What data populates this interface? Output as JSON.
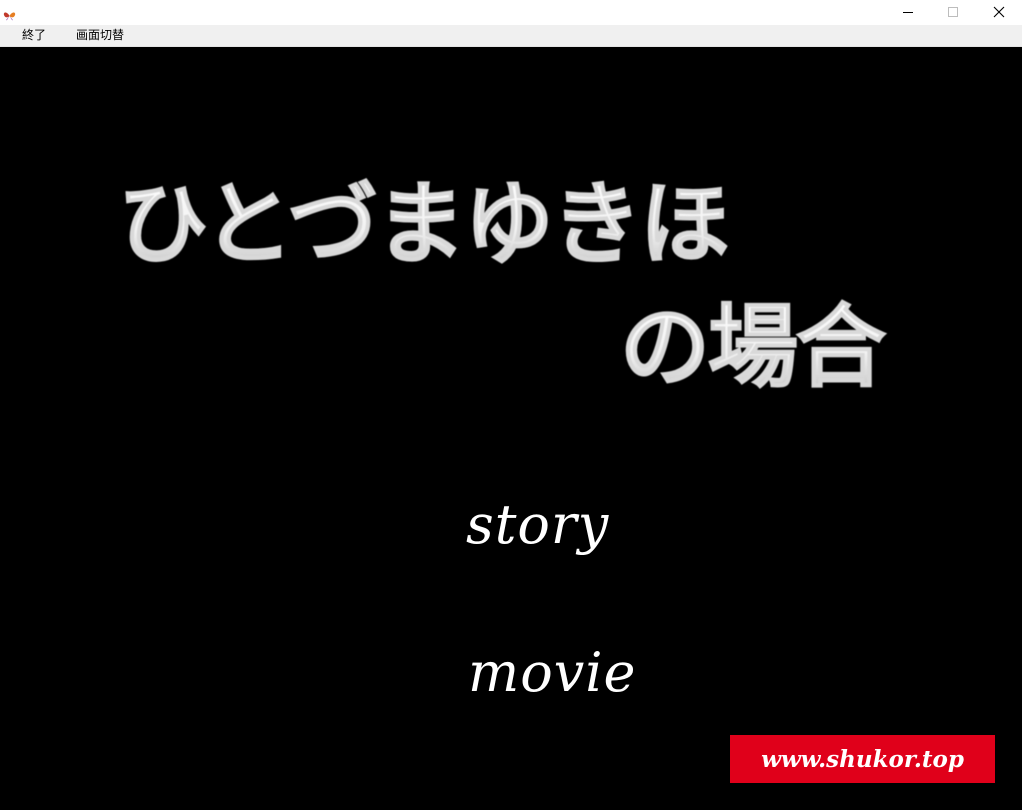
{
  "window": {
    "app_icon": "butterfly-icon",
    "controls": [
      "minimize-icon",
      "maximize-icon",
      "close-icon"
    ]
  },
  "menubar": {
    "items": [
      {
        "label": "終了"
      },
      {
        "label": "画面切替"
      }
    ]
  },
  "game": {
    "logo": {
      "line1": "ひとづまゆきほ",
      "line2": "の場合"
    },
    "choices": [
      {
        "label": "story"
      },
      {
        "label": "movie"
      }
    ]
  },
  "watermark": {
    "text": "www.shukor.top",
    "color": "#e0001a"
  }
}
